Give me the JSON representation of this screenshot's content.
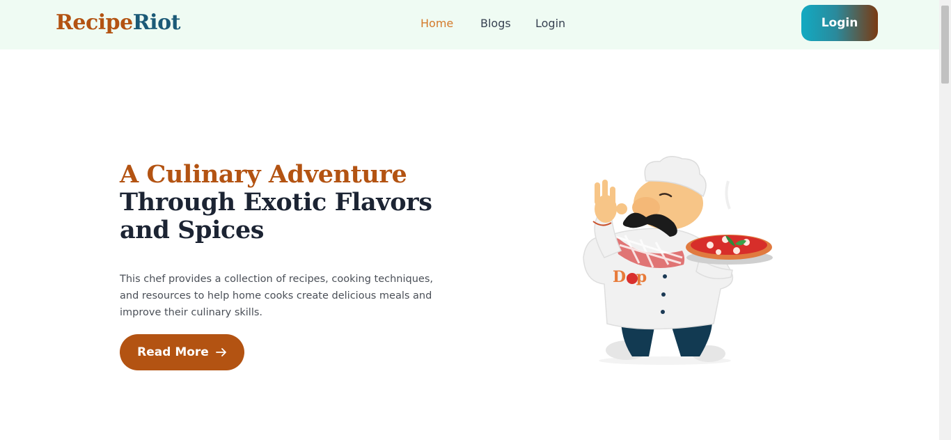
{
  "brand": {
    "part1": "Recipe",
    "part2": "Riot"
  },
  "nav": {
    "items": [
      {
        "label": "Home",
        "active": true
      },
      {
        "label": "Blogs",
        "active": false
      },
      {
        "label": "Login",
        "active": false
      }
    ],
    "login_button": "Login"
  },
  "hero": {
    "title_line1": "A Culinary Adventure",
    "title_line2": "Through Exotic Flavors and Spices",
    "description": "This chef provides a collection of recipes, cooking techniques, and resources to help home cooks create delicious meals and improve their culinary skills.",
    "cta_label": "Read More",
    "cta_icon": "arrow-right-icon",
    "illustration_apron_text": "Dop"
  },
  "colors": {
    "nav_bg": "#effbf3",
    "brand_primary": "#b35312",
    "brand_secondary": "#1b5a77",
    "active_nav": "#d47a2a",
    "heading_dark": "#1c2433",
    "cta_bg": "#b35312"
  }
}
